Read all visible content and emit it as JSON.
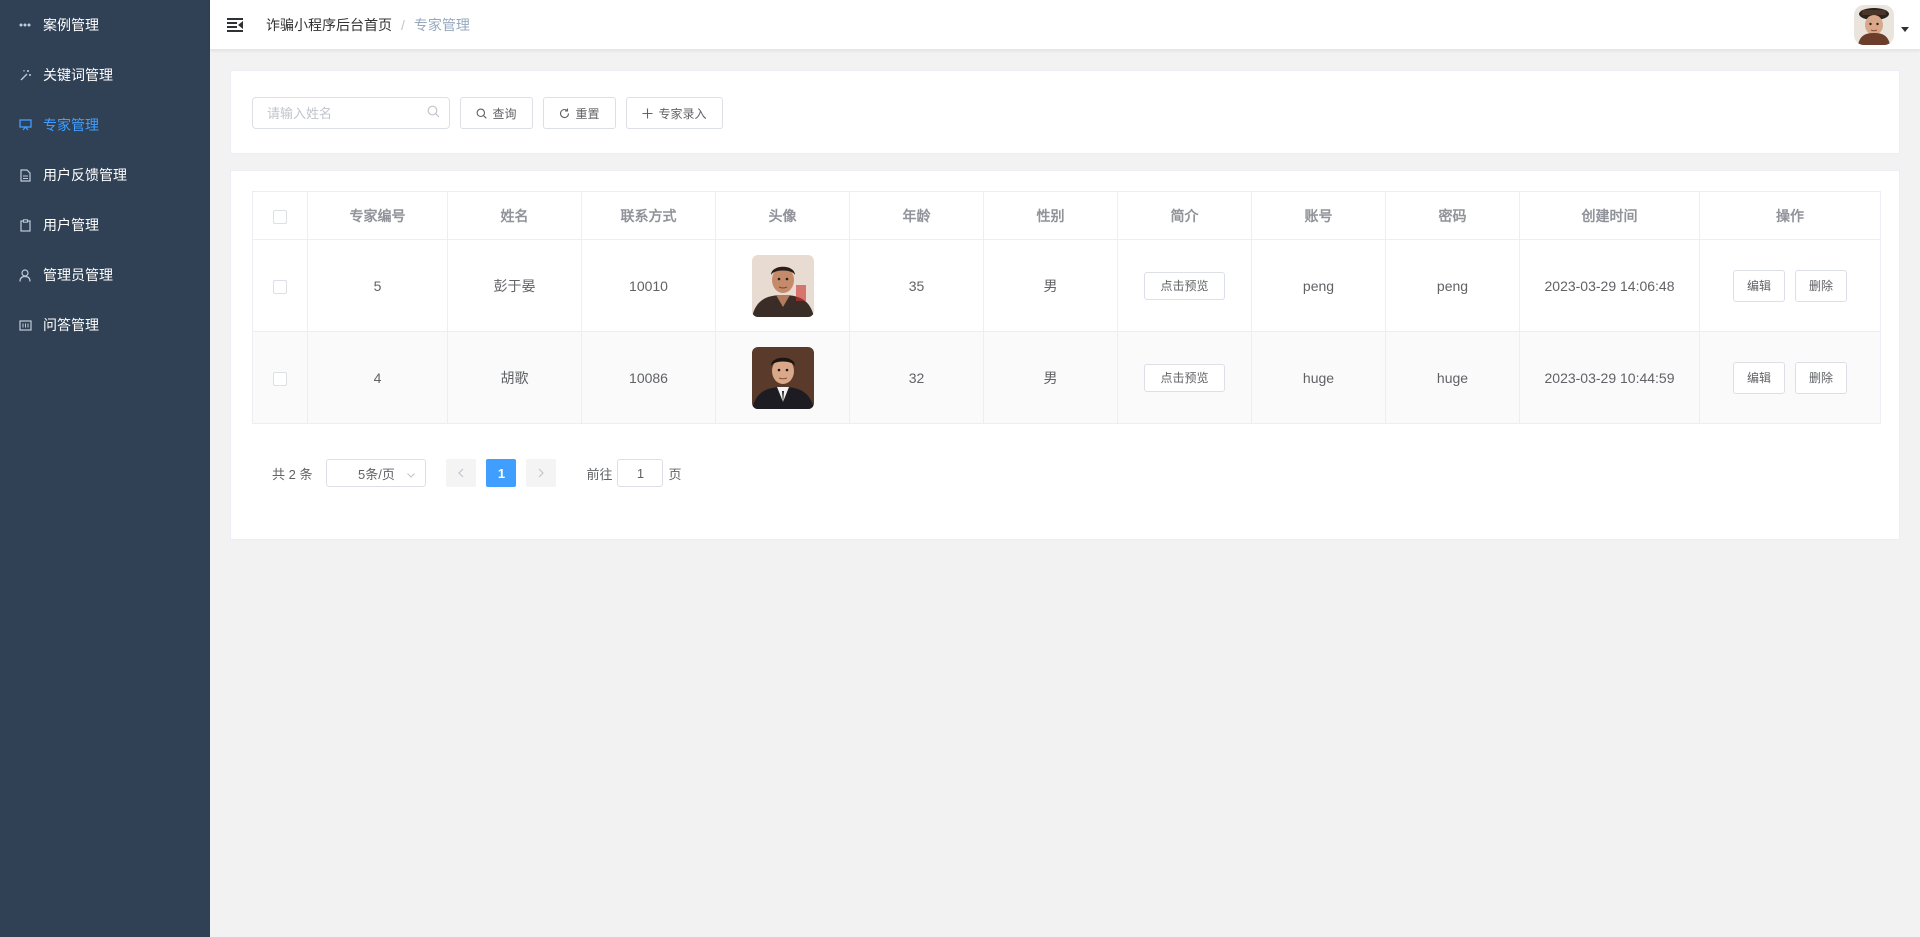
{
  "sidebar": {
    "items": [
      {
        "label": "案例管理",
        "icon": "more-icon",
        "active": false
      },
      {
        "label": "关键词管理",
        "icon": "magic-stick-icon",
        "active": false
      },
      {
        "label": "专家管理",
        "icon": "monitor-icon",
        "active": true
      },
      {
        "label": "用户反馈管理",
        "icon": "document-icon",
        "active": false
      },
      {
        "label": "用户管理",
        "icon": "clipboard-icon",
        "active": false
      },
      {
        "label": "管理员管理",
        "icon": "user-icon",
        "active": false
      },
      {
        "label": "问答管理",
        "icon": "tickets-icon",
        "active": false
      }
    ]
  },
  "header": {
    "breadcrumb_home": "诈骗小程序后台首页",
    "breadcrumb_sep": "/",
    "breadcrumb_current": "专家管理"
  },
  "search": {
    "placeholder": "请输入姓名",
    "query_label": "查询",
    "reset_label": "重置",
    "add_label": "专家录入"
  },
  "table": {
    "columns": [
      "专家编号",
      "姓名",
      "联系方式",
      "头像",
      "年龄",
      "性别",
      "简介",
      "账号",
      "密码",
      "创建时间",
      "操作"
    ],
    "rows": [
      {
        "id": "5",
        "name": "彭于晏",
        "contact": "10010",
        "age": "35",
        "gender": "男",
        "intro": "点击预览",
        "account": "peng",
        "password": "peng",
        "created": "2023-03-29 14:06:48",
        "edit": "编辑",
        "delete": "删除"
      },
      {
        "id": "4",
        "name": "胡歌",
        "contact": "10086",
        "age": "32",
        "gender": "男",
        "intro": "点击预览",
        "account": "huge",
        "password": "huge",
        "created": "2023-03-29 10:44:59",
        "edit": "编辑",
        "delete": "删除"
      }
    ]
  },
  "pagination": {
    "total": "共 2 条",
    "page_size": "5条/页",
    "current_page": "1",
    "goto_prefix": "前往",
    "goto_value": "1",
    "goto_suffix": "页"
  },
  "colors": {
    "sidebar_bg": "#304156",
    "accent": "#409eff"
  }
}
